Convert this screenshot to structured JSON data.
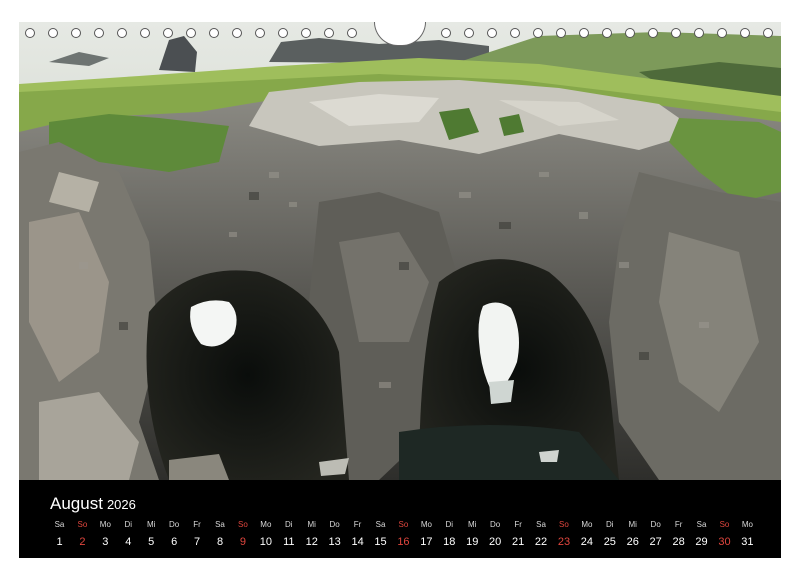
{
  "calendar": {
    "month": "August",
    "year": "2026",
    "sunday_color": "#e0463e",
    "days": [
      {
        "dow": "Sa",
        "num": "1"
      },
      {
        "dow": "So",
        "num": "2",
        "sunday": true
      },
      {
        "dow": "Mo",
        "num": "3"
      },
      {
        "dow": "Di",
        "num": "4"
      },
      {
        "dow": "Mi",
        "num": "5"
      },
      {
        "dow": "Do",
        "num": "6"
      },
      {
        "dow": "Fr",
        "num": "7"
      },
      {
        "dow": "Sa",
        "num": "8"
      },
      {
        "dow": "So",
        "num": "9",
        "sunday": true
      },
      {
        "dow": "Mo",
        "num": "10"
      },
      {
        "dow": "Di",
        "num": "11"
      },
      {
        "dow": "Mi",
        "num": "12"
      },
      {
        "dow": "Do",
        "num": "13"
      },
      {
        "dow": "Fr",
        "num": "14"
      },
      {
        "dow": "Sa",
        "num": "15"
      },
      {
        "dow": "So",
        "num": "16",
        "sunday": true
      },
      {
        "dow": "Mo",
        "num": "17"
      },
      {
        "dow": "Di",
        "num": "18"
      },
      {
        "dow": "Mi",
        "num": "19"
      },
      {
        "dow": "Do",
        "num": "20"
      },
      {
        "dow": "Fr",
        "num": "21"
      },
      {
        "dow": "Sa",
        "num": "22"
      },
      {
        "dow": "So",
        "num": "23",
        "sunday": true
      },
      {
        "dow": "Mo",
        "num": "24"
      },
      {
        "dow": "Di",
        "num": "25"
      },
      {
        "dow": "Mi",
        "num": "26"
      },
      {
        "dow": "Do",
        "num": "27"
      },
      {
        "dow": "Fr",
        "num": "28"
      },
      {
        "dow": "Sa",
        "num": "29"
      },
      {
        "dow": "So",
        "num": "30",
        "sunday": true
      },
      {
        "dow": "Mo",
        "num": "31"
      }
    ]
  }
}
